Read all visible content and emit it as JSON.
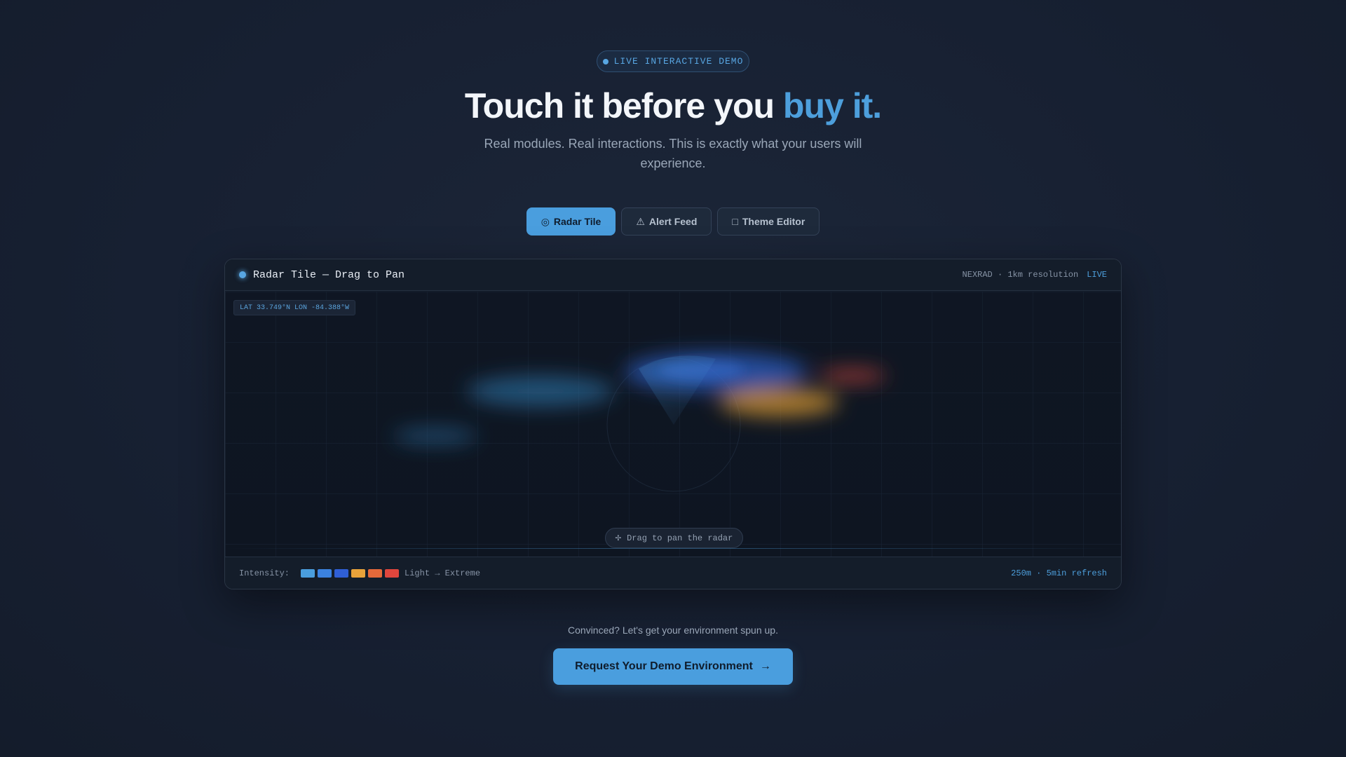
{
  "badge": {
    "label": "LIVE INTERACTIVE DEMO"
  },
  "hero": {
    "title_main": "Touch it before you ",
    "title_accent": "buy it.",
    "subtitle": "Real modules. Real interactions. This is exactly what your users will experience."
  },
  "tabs": [
    {
      "icon": "◎",
      "label": "Radar Tile",
      "active": true
    },
    {
      "icon": "⚠",
      "label": "Alert Feed",
      "active": false
    },
    {
      "icon": "□",
      "label": "Theme Editor",
      "active": false
    }
  ],
  "panel": {
    "title": "Radar Tile — Drag to Pan",
    "meta": "NEXRAD · 1km resolution",
    "live": "LIVE",
    "coords": "LAT 33.749°N  LON -84.388°W",
    "drag_hint": "Drag to pan the radar",
    "drag_icon": "✢"
  },
  "legend": {
    "label": "Intensity:",
    "colors": [
      "#4a9ede",
      "#3b82e0",
      "#2f5fd6",
      "#e8a23a",
      "#e5693a",
      "#e0463d"
    ],
    "range": "Light → Extreme",
    "refresh": "250m · 5min refresh"
  },
  "cta": {
    "text": "Convinced? Let's get your environment spun up.",
    "button": "Request Your Demo Environment",
    "arrow": "→"
  }
}
